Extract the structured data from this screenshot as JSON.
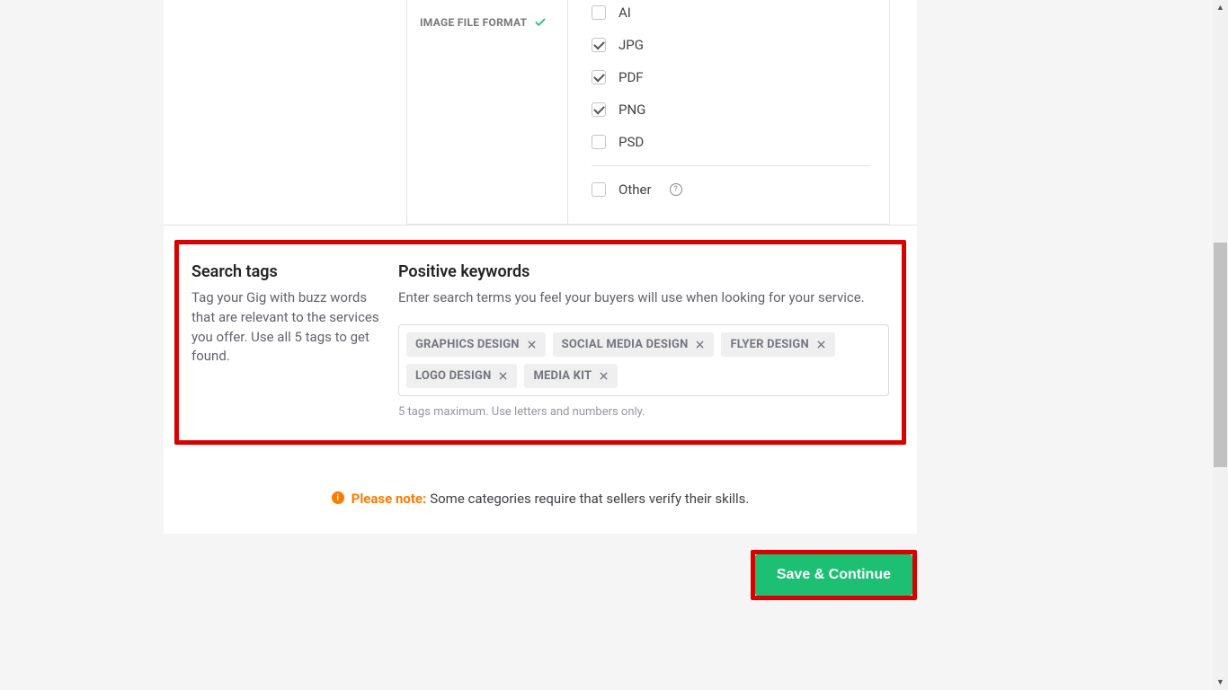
{
  "imageFileFormat": {
    "label": "IMAGE FILE FORMAT",
    "options": [
      {
        "label": "AI",
        "checked": false
      },
      {
        "label": "JPG",
        "checked": true
      },
      {
        "label": "PDF",
        "checked": true
      },
      {
        "label": "PNG",
        "checked": true
      },
      {
        "label": "PSD",
        "checked": false
      }
    ],
    "other": {
      "label": "Other",
      "checked": false
    }
  },
  "searchTags": {
    "heading": "Search tags",
    "description": "Tag your Gig with buzz words that are relevant to the services you offer. Use all 5 tags to get found."
  },
  "positiveKeywords": {
    "heading": "Positive keywords",
    "description": "Enter search terms you feel your buyers will use when looking for your service.",
    "tags": [
      "GRAPHICS DESIGN",
      "SOCIAL MEDIA DESIGN",
      "FLYER DESIGN",
      "LOGO DESIGN",
      "MEDIA KIT"
    ],
    "hint": "5 tags maximum. Use letters and numbers only."
  },
  "note": {
    "label": "Please note:",
    "text": "Some categories require that sellers verify their skills."
  },
  "actions": {
    "saveContinue": "Save & Continue"
  }
}
